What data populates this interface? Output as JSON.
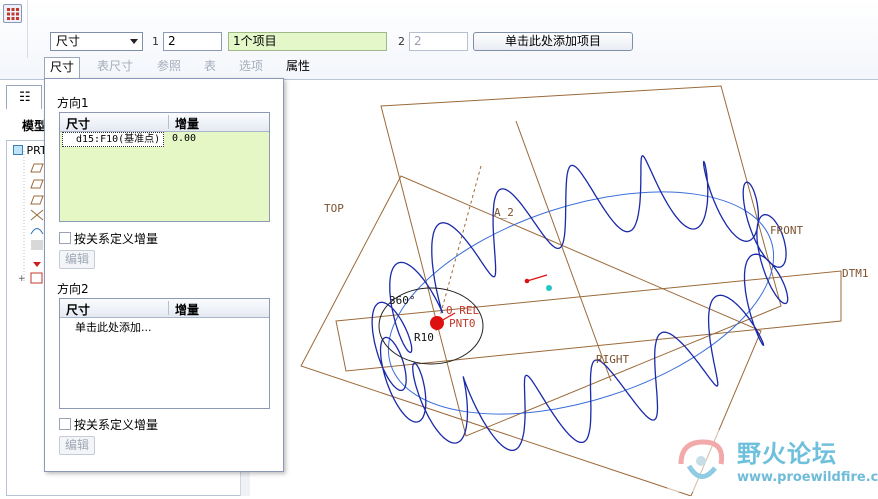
{
  "ribbon": {
    "dimension_dropdown": "尺寸",
    "dir1_label": "1",
    "dir1_count": "2",
    "dir1_items": "1个项目",
    "dir2_label": "2",
    "dir2_count": "2",
    "add_item_button": "单击此处添加项目"
  },
  "tabs": [
    {
      "label": "尺寸",
      "state": "active"
    },
    {
      "label": "表尺寸",
      "state": "disabled"
    },
    {
      "label": "参照",
      "state": "disabled"
    },
    {
      "label": "表",
      "state": "disabled"
    },
    {
      "label": "选项",
      "state": "disabled"
    },
    {
      "label": "属性",
      "state": "normal"
    }
  ],
  "tree": {
    "tab_icon": "model-tree-icon",
    "title": "模型",
    "root": "PRT"
  },
  "panel": {
    "direction1": {
      "title": "方向1",
      "col_dimension": "尺寸",
      "col_increment": "增量",
      "rows": [
        {
          "dimension": "d15:F10(基准点)",
          "increment": "0.00"
        }
      ],
      "relation_checkbox": "按关系定义增量",
      "edit_button": "编辑"
    },
    "direction2": {
      "title": "方向2",
      "col_dimension": "尺寸",
      "col_increment": "增量",
      "placeholder_row": "单击此处添加...",
      "relation_checkbox": "按关系定义增量",
      "edit_button": "编辑"
    }
  },
  "viewport": {
    "labels": {
      "top": "TOP",
      "front": "FRONT",
      "right": "RIGHT",
      "dtm1": "DTM1",
      "axis": "A_2",
      "angle": "360°",
      "radius": "R10",
      "ref": "0 REL",
      "pnt": "PNT0"
    },
    "colors": {
      "datum": "#9b6a3a",
      "spring": "#1a2aa8",
      "path": "#3a6ed8"
    }
  },
  "watermark": {
    "title": "野火论坛",
    "url": "www.proewildfire.cn"
  }
}
